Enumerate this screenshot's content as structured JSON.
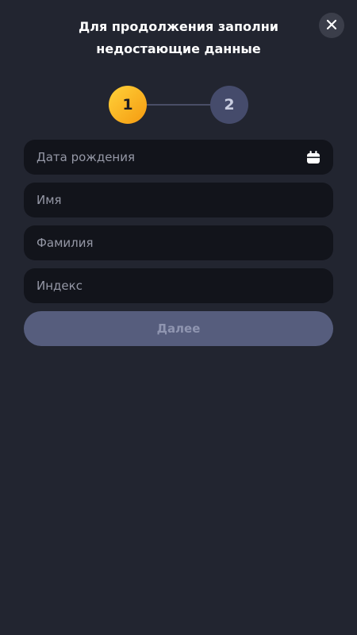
{
  "header": {
    "title_line1": "Для продолжения заполни",
    "title_line2": "недостающие данные",
    "close_icon": "close-icon"
  },
  "stepper": {
    "steps": [
      {
        "label": "1",
        "state": "active"
      },
      {
        "label": "2",
        "state": "inactive"
      }
    ]
  },
  "form": {
    "fields": [
      {
        "placeholder": "Дата рождения",
        "value": "",
        "icon": "calendar-icon"
      },
      {
        "placeholder": "Имя",
        "value": ""
      },
      {
        "placeholder": "Фамилия",
        "value": ""
      },
      {
        "placeholder": "Индекс",
        "value": ""
      }
    ],
    "submit_label": "Далее"
  },
  "colors": {
    "background": "#222530",
    "field_background": "#12141b",
    "active_step": "#f8b51e",
    "inactive_step": "#454b6b",
    "button_disabled": "#565d7d"
  }
}
